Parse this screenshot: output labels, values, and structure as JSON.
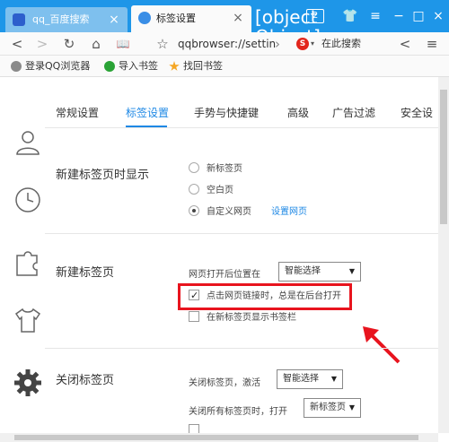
{
  "tabs": [
    {
      "title": "qq_百度搜索",
      "close": "×"
    },
    {
      "title": "标签设置",
      "close": "×"
    }
  ],
  "new_tab": {
    "title": "新建标签页",
    "open_position_label": "网页打开后位置在",
    "open_position_value": "智能选择",
    "background_open_label": "点击网页链接时，总是在后台打开",
    "background_open_checked": true,
    "show_bookmark_bar_label": "在新标签页显示书签栏",
    "show_bookmark_bar_checked": false
  },
  "tab_count": "2",
  "window": {
    "shirt": "👕",
    "menu": "≡",
    "minimize": "−",
    "maximize": "□",
    "close": "×"
  },
  "nav": {
    "back": "<",
    "forward": ">",
    "reload": "↻",
    "home": "⌂",
    "reader": "📖",
    "favorite": "☆",
    "address": "qqbrowser://settin",
    "more": "›",
    "search_engine": "S",
    "search_caret": "▾",
    "search_placeholder": "在此搜索",
    "search_prev": "<",
    "more_menu": "≡"
  },
  "bookmarks": [
    {
      "label": "登录QQ浏览器"
    },
    {
      "label": "导入书签"
    },
    {
      "label": "找回书签"
    }
  ],
  "settings_tabs": [
    "常规设置",
    "标签设置",
    "手势与快捷键",
    "高级",
    "广告过滤",
    "安全设"
  ],
  "new_tab_page": {
    "title": "新建标签页时显示",
    "options": [
      "新标签页",
      "空白页",
      "自定义网页"
    ],
    "selected_index": 2,
    "set_link": "设置网页"
  },
  "close_tab": {
    "title": "关闭标签页",
    "activate_label": "关闭标签页，激活",
    "activate_value": "智能选择",
    "close_all_label": "关闭所有标签页时，打开",
    "close_all_value": "新标签页"
  },
  "colors": {
    "accent": "#1e88e5",
    "titlebar": "#1e96e8",
    "highlight": "#e8141e"
  }
}
